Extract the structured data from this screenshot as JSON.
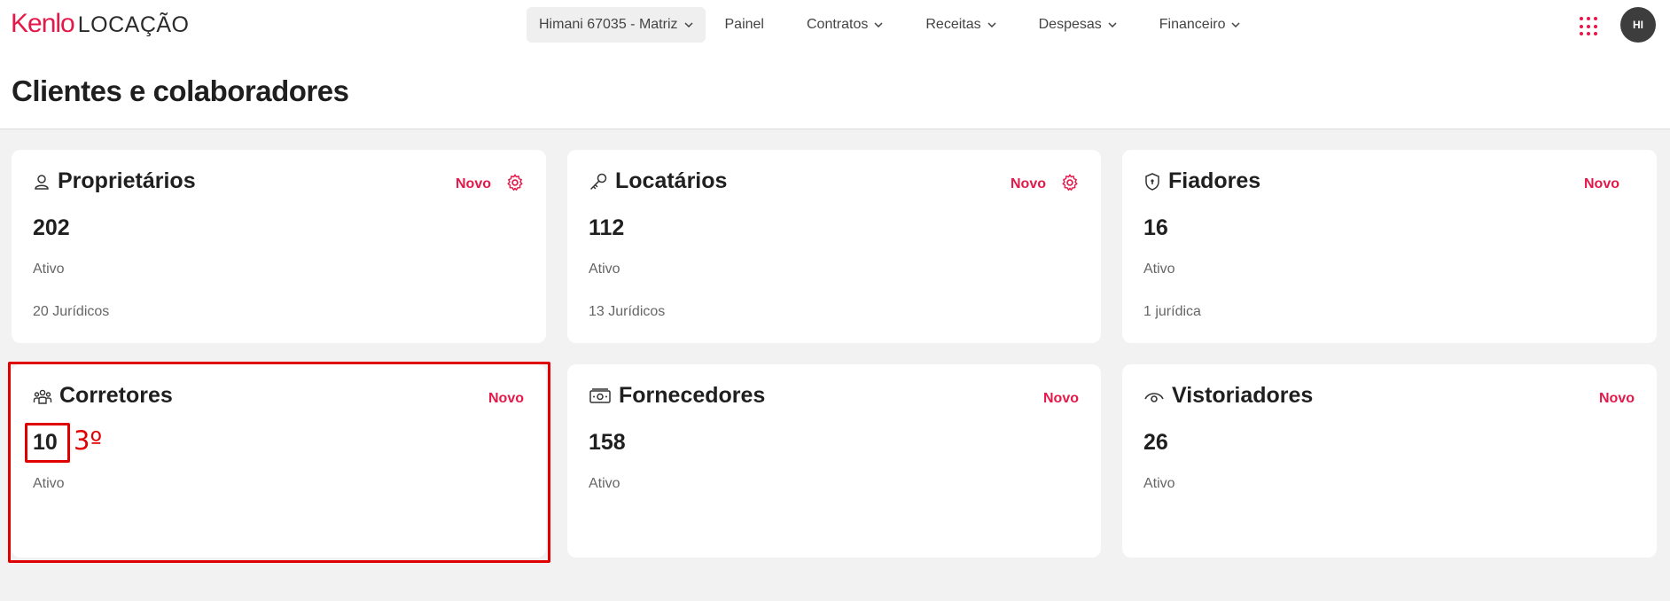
{
  "brand": {
    "logo_brand": "Kenlo",
    "logo_product": "LOCAÇÃO",
    "accent": "#e5184a"
  },
  "nav": {
    "branch": "Himani 67035 - Matriz",
    "items": [
      {
        "label": "Painel",
        "dropdown": false
      },
      {
        "label": "Contratos",
        "dropdown": true
      },
      {
        "label": "Receitas",
        "dropdown": true
      },
      {
        "label": "Despesas",
        "dropdown": true
      },
      {
        "label": "Financeiro",
        "dropdown": true
      }
    ]
  },
  "user": {
    "initials": "HI"
  },
  "page": {
    "title": "Clientes e colaboradores"
  },
  "cards": [
    {
      "title": "Proprietários",
      "icon": "user-icon",
      "count": "202",
      "status": "Ativo",
      "juridicos": "20 Jurídicos",
      "new_label": "Novo",
      "settings": true
    },
    {
      "title": "Locatários",
      "icon": "key-icon",
      "count": "112",
      "status": "Ativo",
      "juridicos": "13 Jurídicos",
      "new_label": "Novo",
      "settings": true
    },
    {
      "title": "Fiadores",
      "icon": "shield-icon",
      "count": "16",
      "status": "Ativo",
      "juridicos": "1 jurídica",
      "new_label": "Novo",
      "settings": false
    },
    {
      "title": "Corretores",
      "icon": "people-icon",
      "count": "10",
      "status": "Ativo",
      "juridicos": "",
      "new_label": "Novo",
      "settings": false
    },
    {
      "title": "Fornecedores",
      "icon": "cash-icon",
      "count": "158",
      "status": "Ativo",
      "juridicos": "",
      "new_label": "Novo",
      "settings": false
    },
    {
      "title": "Vistoriadores",
      "icon": "eye-icon",
      "count": "26",
      "status": "Ativo",
      "juridicos": "",
      "new_label": "Novo",
      "settings": false
    }
  ],
  "annotation": {
    "label": "3º",
    "color": "#e00000"
  }
}
